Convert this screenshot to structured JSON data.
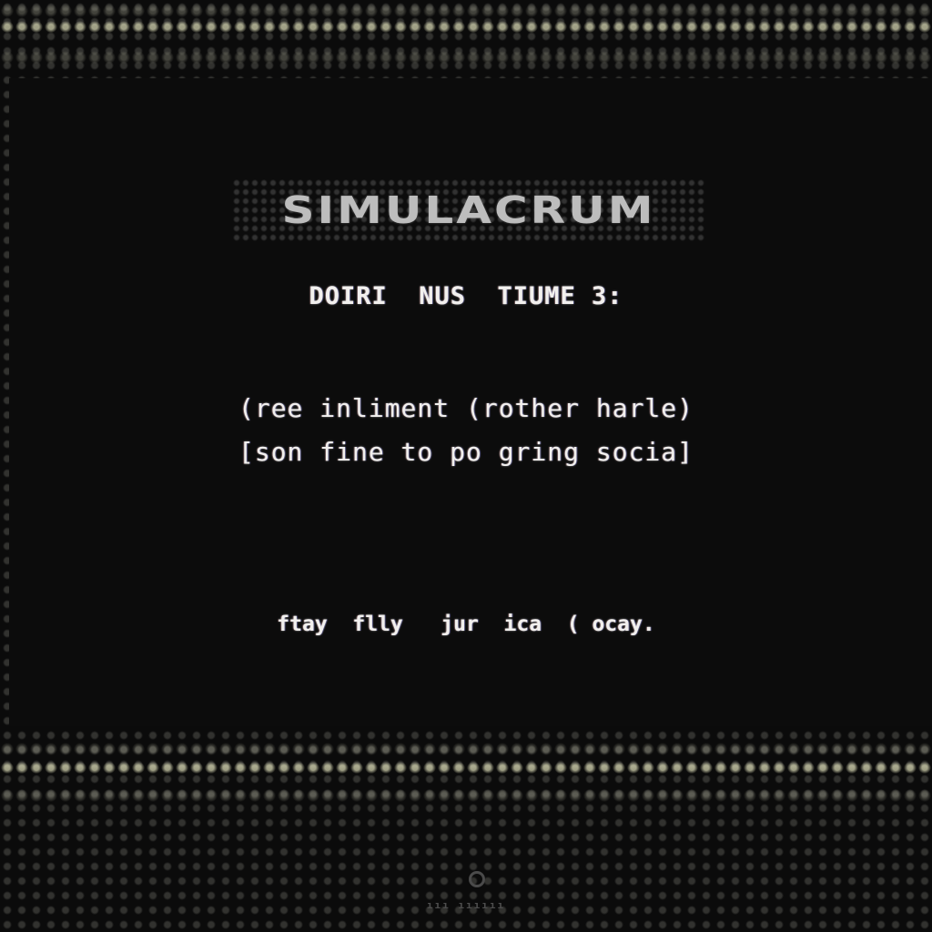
{
  "screen": {
    "title": "SIMULACRUM",
    "subtitle": "DOIRI  NUS  TIUME 3:",
    "body_lines": [
      "(ree inliment (rother harle)",
      "[son fine to po gring socia]"
    ],
    "prompt": "ftay  flly   jur  ica  ( ocay.",
    "footer": {
      "icon": "circle-logo-icon",
      "text": "ııı ıııııı"
    }
  },
  "colors": {
    "background": "#0a0a0a",
    "text": "#f2f0ee",
    "title": "#bdbdbd",
    "grid_highlight": "#d2d2af"
  }
}
